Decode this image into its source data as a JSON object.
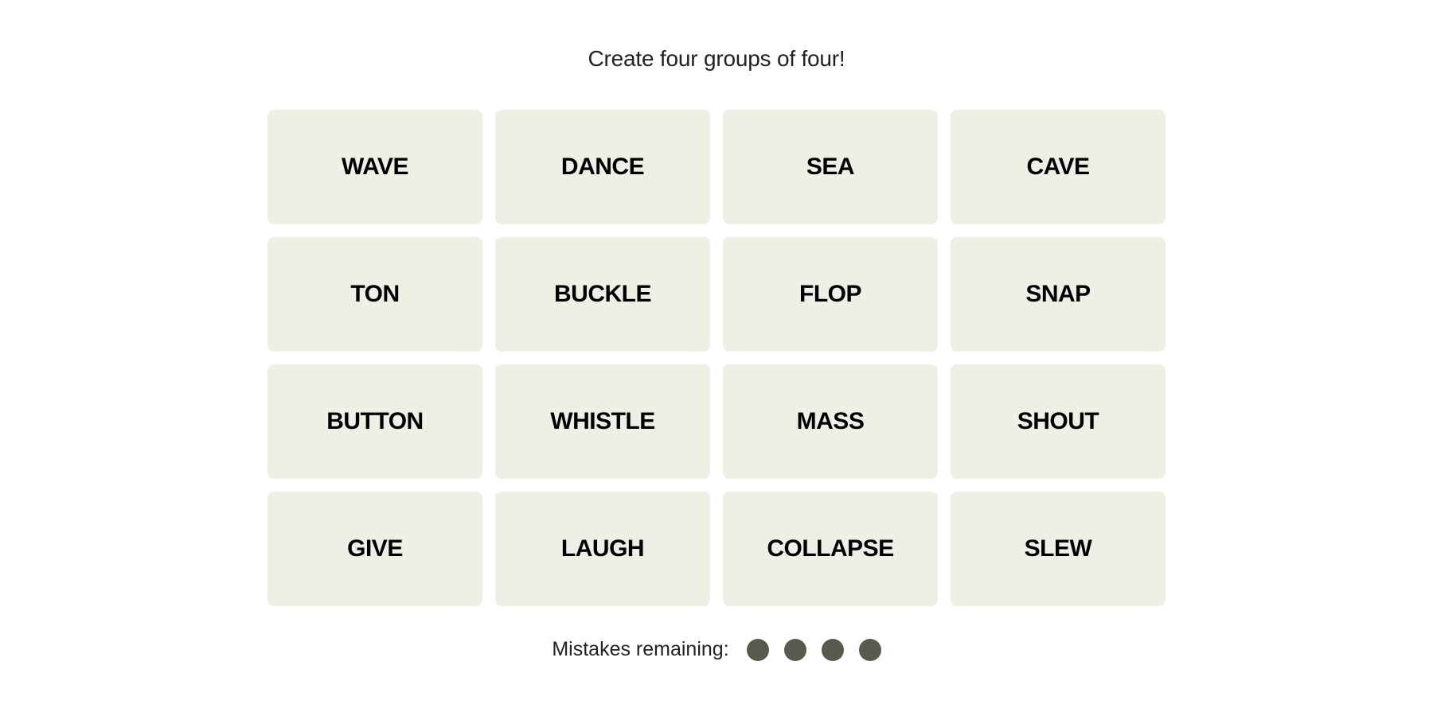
{
  "header": {
    "instructions": "Create four groups of four!"
  },
  "board": {
    "tiles": [
      {
        "word": "WAVE"
      },
      {
        "word": "DANCE"
      },
      {
        "word": "SEA"
      },
      {
        "word": "CAVE"
      },
      {
        "word": "TON"
      },
      {
        "word": "BUCKLE"
      },
      {
        "word": "FLOP"
      },
      {
        "word": "SNAP"
      },
      {
        "word": "BUTTON"
      },
      {
        "word": "WHISTLE"
      },
      {
        "word": "MASS"
      },
      {
        "word": "SHOUT"
      },
      {
        "word": "GIVE"
      },
      {
        "word": "LAUGH"
      },
      {
        "word": "COLLAPSE"
      },
      {
        "word": "SLEW"
      }
    ],
    "tile_color": "#efefe6"
  },
  "status": {
    "mistakes_label": "Mistakes remaining:",
    "mistakes_remaining": 4,
    "dot_color": "#5a594e"
  }
}
